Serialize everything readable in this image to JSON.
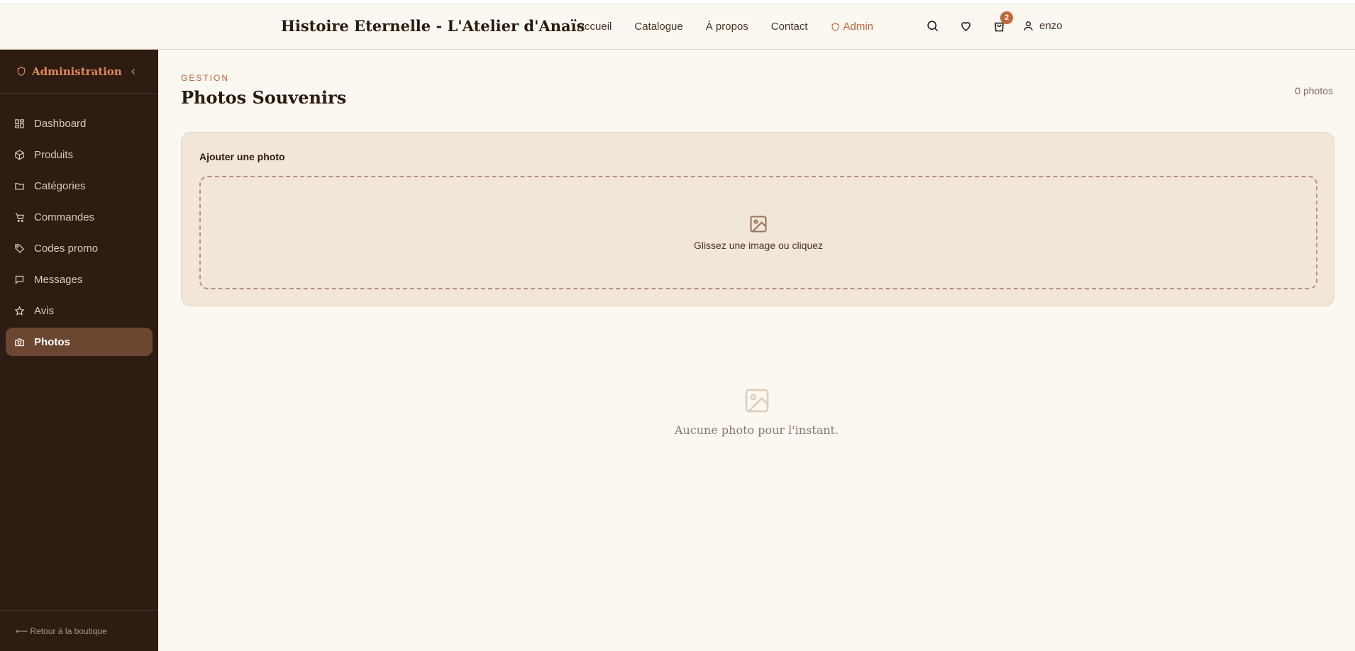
{
  "header": {
    "brand": "Histoire Eternelle - L'Atelier d'Anaïs",
    "nav": [
      {
        "label": "Accueil"
      },
      {
        "label": "Catalogue"
      },
      {
        "label": "À propos"
      },
      {
        "label": "Contact"
      },
      {
        "label": "Admin",
        "icon": "shield-icon"
      }
    ],
    "icons": [
      "search-icon",
      "heart-icon",
      "bag-icon",
      "user-icon"
    ],
    "cart_count": "2",
    "username": "enzo"
  },
  "sidebar": {
    "title": "Administration",
    "items": [
      {
        "label": "Dashboard",
        "icon": "dashboard-icon"
      },
      {
        "label": "Produits",
        "icon": "box-icon"
      },
      {
        "label": "Catégories",
        "icon": "folder-icon"
      },
      {
        "label": "Commandes",
        "icon": "cart-icon"
      },
      {
        "label": "Codes promo",
        "icon": "tag-icon"
      },
      {
        "label": "Messages",
        "icon": "message-icon"
      },
      {
        "label": "Avis",
        "icon": "star-icon"
      },
      {
        "label": "Photos",
        "icon": "camera-icon",
        "active": true
      }
    ],
    "footer_link": "⟵ Retour à la boutique"
  },
  "main": {
    "eyebrow": "GESTION",
    "title": "Photos Souvenirs",
    "count": "0 photos",
    "upload": {
      "title": "Ajouter une photo",
      "drop_text": "Glissez une image ou cliquez"
    },
    "empty_text": "Aucune photo pour l'instant."
  },
  "colors": {
    "accent": "#c0663a",
    "sidebar_bg": "#2e1c12",
    "active_item": "#6b4631",
    "page_bg": "#fbf7f1",
    "card_bg": "#f1e6d7"
  }
}
